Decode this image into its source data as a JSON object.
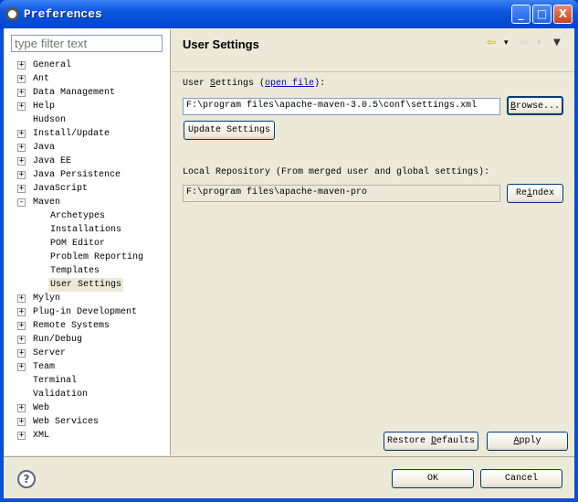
{
  "window": {
    "title": "Preferences",
    "minimize": "_",
    "maximize": "□",
    "close": "X"
  },
  "filter": {
    "placeholder": "type filter text"
  },
  "tree": [
    {
      "label": "General",
      "exp": "+",
      "level": 0
    },
    {
      "label": "Ant",
      "exp": "+",
      "level": 0
    },
    {
      "label": "Data Management",
      "exp": "+",
      "level": 0
    },
    {
      "label": "Help",
      "exp": "+",
      "level": 0
    },
    {
      "label": "Hudson",
      "exp": "",
      "level": 0
    },
    {
      "label": "Install/Update",
      "exp": "+",
      "level": 0
    },
    {
      "label": "Java",
      "exp": "+",
      "level": 0
    },
    {
      "label": "Java EE",
      "exp": "+",
      "level": 0
    },
    {
      "label": "Java Persistence",
      "exp": "+",
      "level": 0
    },
    {
      "label": "JavaScript",
      "exp": "+",
      "level": 0
    },
    {
      "label": "Maven",
      "exp": "-",
      "level": 0
    },
    {
      "label": "Archetypes",
      "exp": "",
      "level": 1
    },
    {
      "label": "Installations",
      "exp": "",
      "level": 1
    },
    {
      "label": "POM Editor",
      "exp": "",
      "level": 1
    },
    {
      "label": "Problem Reporting",
      "exp": "",
      "level": 1
    },
    {
      "label": "Templates",
      "exp": "",
      "level": 1
    },
    {
      "label": "User Settings",
      "exp": "",
      "level": 1,
      "selected": true
    },
    {
      "label": "Mylyn",
      "exp": "+",
      "level": 0
    },
    {
      "label": "Plug-in Development",
      "exp": "+",
      "level": 0
    },
    {
      "label": "Remote Systems",
      "exp": "+",
      "level": 0
    },
    {
      "label": "Run/Debug",
      "exp": "+",
      "level": 0
    },
    {
      "label": "Server",
      "exp": "+",
      "level": 0
    },
    {
      "label": "Team",
      "exp": "+",
      "level": 0
    },
    {
      "label": "Terminal",
      "exp": "",
      "level": 0
    },
    {
      "label": "Validation",
      "exp": "",
      "level": 0
    },
    {
      "label": "Web",
      "exp": "+",
      "level": 0
    },
    {
      "label": "Web Services",
      "exp": "+",
      "level": 0
    },
    {
      "label": "XML",
      "exp": "+",
      "level": 0
    }
  ],
  "page": {
    "title": "User Settings",
    "user_settings_label_pre": "User ",
    "user_settings_label_mn": "S",
    "user_settings_label_post": "ettings (",
    "open_file": "open file",
    "user_settings_label_end": "):",
    "user_settings_value": "F:\\program files\\apache-maven-3.0.5\\conf\\settings.xml",
    "browse_mn": "B",
    "browse_rest": "rowse...",
    "update_settings": "Update Settings",
    "local_repo_label": "Local Repository (From merged user and global settings):",
    "local_repo_value": "F:\\program files\\apache-maven-pro",
    "reindex_pre": "Re",
    "reindex_mn": "i",
    "reindex_post": "ndex",
    "restore_pre": "Restore ",
    "restore_mn": "D",
    "restore_post": "efaults",
    "apply_mn": "A",
    "apply_post": "pply"
  },
  "nav": {
    "back": "⇦",
    "forward": "⇨",
    "dropdown": "▾",
    "menu": "▼"
  },
  "footer": {
    "help": "?",
    "ok": "OK",
    "cancel": "Cancel"
  }
}
